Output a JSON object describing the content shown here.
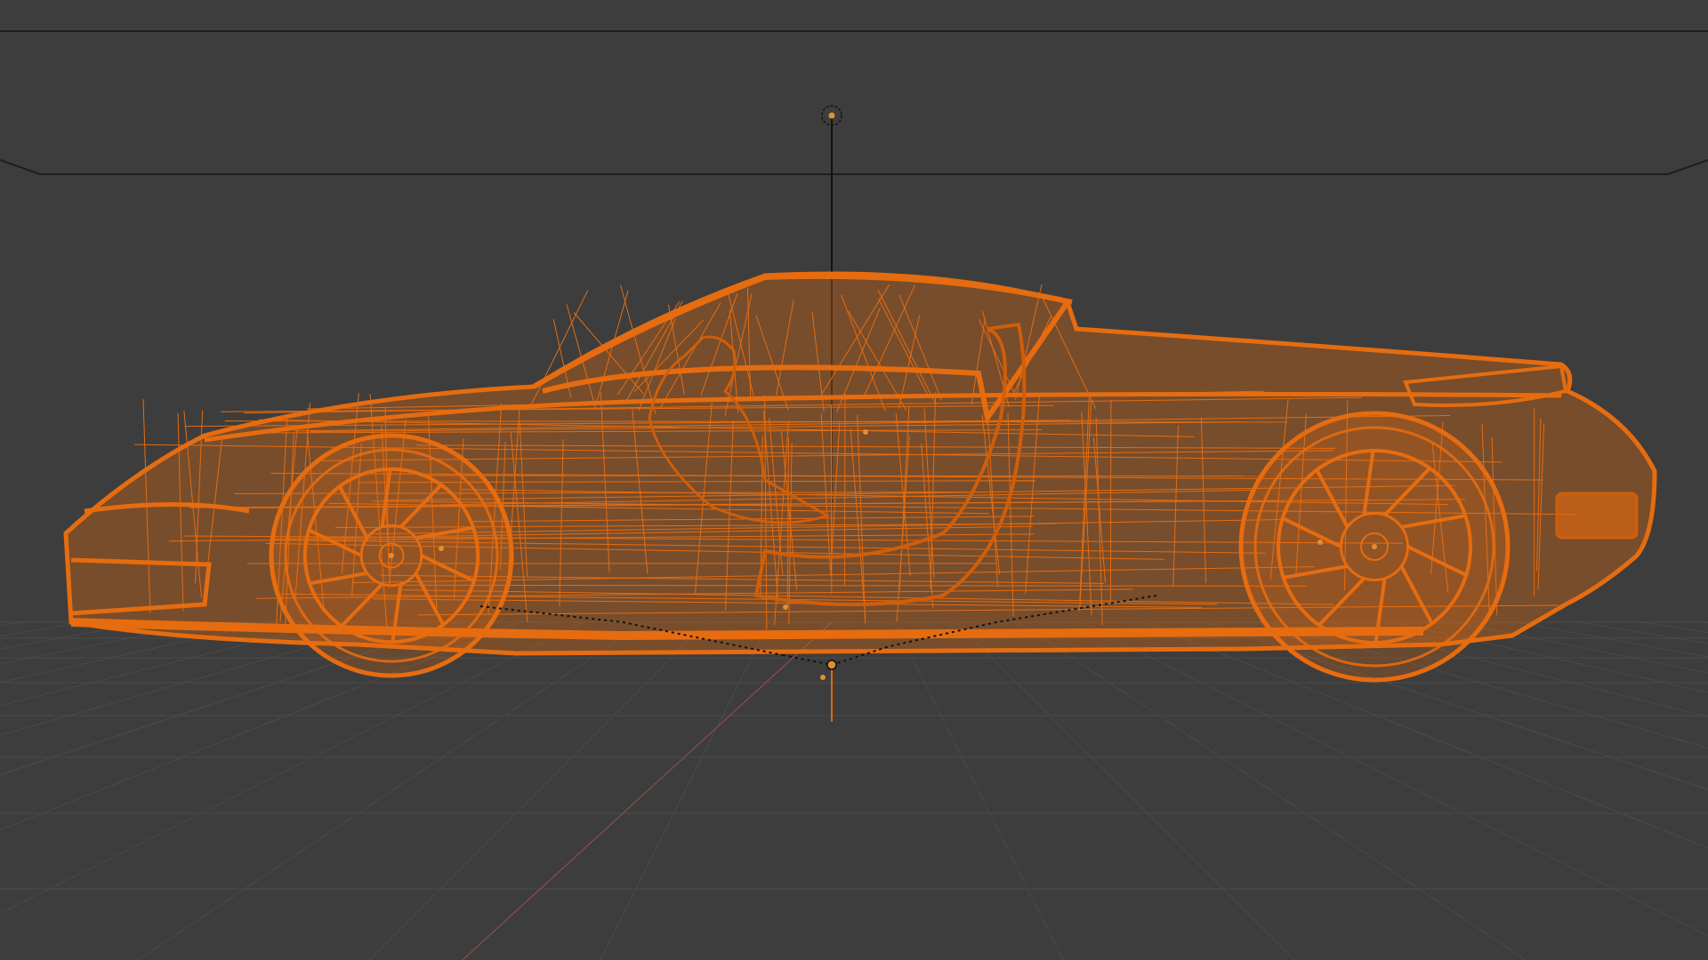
{
  "app": {
    "editor": "3D Viewport",
    "shading": "wireframe",
    "view": "side-orthographic"
  },
  "viewport": {
    "background_color": "#3d3d3d",
    "grid_color": "#4a4a4a",
    "horizon_line_color": "#222222",
    "red_axis_color": "#9a4f4f"
  },
  "selection": {
    "object": "car-model",
    "selected": true,
    "highlight_color": "#e66c0f",
    "wire_dark_color": "#8a3a05"
  },
  "origin": {
    "color": "#e09030",
    "pivot_line_color": "#111111"
  },
  "icons": {
    "empty-target": "dashed-circle",
    "object-origin": "dot"
  }
}
